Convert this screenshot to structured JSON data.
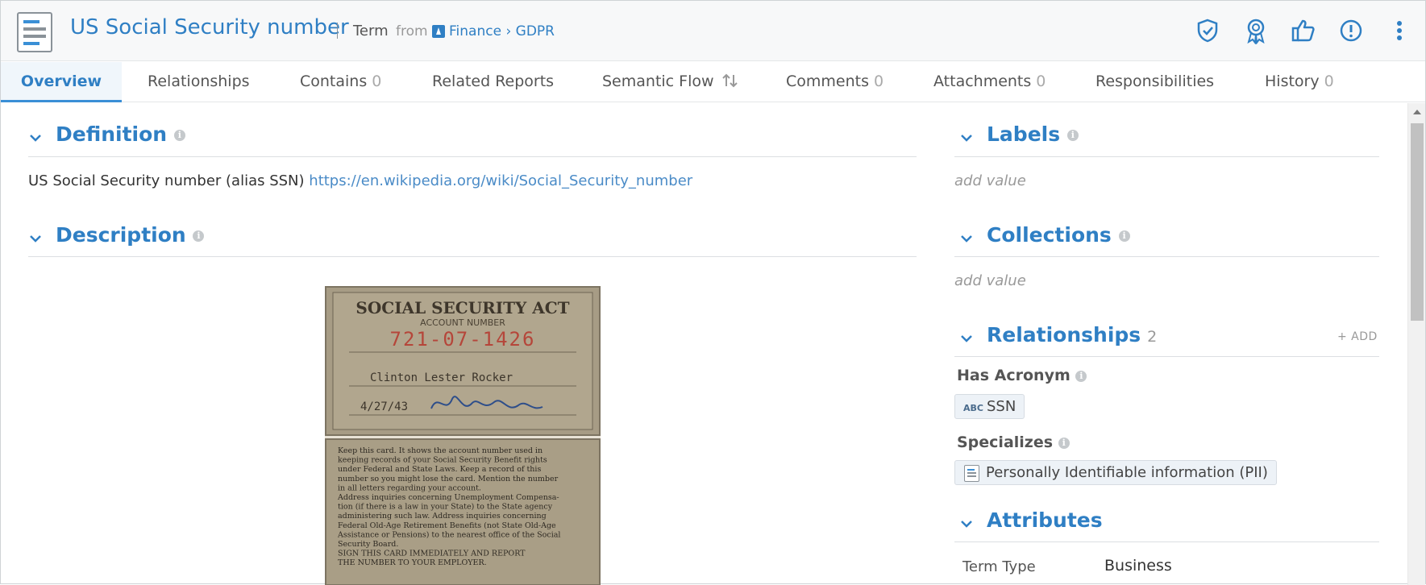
{
  "header": {
    "title": "US Social Security number",
    "type": "Term",
    "from": "from",
    "breadcrumb": "Finance › GDPR",
    "actions": [
      {
        "icon": "shield-check-icon"
      },
      {
        "icon": "award-icon"
      },
      {
        "icon": "thumbs-up-icon"
      },
      {
        "icon": "alert-icon"
      },
      {
        "icon": "more-vertical-icon"
      }
    ]
  },
  "tabs": [
    {
      "label": "Overview",
      "count": "",
      "active": true
    },
    {
      "label": "Relationships",
      "count": ""
    },
    {
      "label": "Contains",
      "count": "0"
    },
    {
      "label": "Related Reports",
      "count": ""
    },
    {
      "label": "Semantic Flow",
      "count": ""
    },
    {
      "label": "Comments",
      "count": "0"
    },
    {
      "label": "Attachments",
      "count": "0"
    },
    {
      "label": "Responsibilities",
      "count": ""
    },
    {
      "label": "History",
      "count": "0"
    }
  ],
  "definition": {
    "title": "Definition",
    "text": "US Social Security number (alias SSN)",
    "link": "https://en.wikipedia.org/wiki/Social_Security_number"
  },
  "description": {
    "title": "Description",
    "card": {
      "header": "SOCIAL SECURITY ACT",
      "sub": "ACCOUNT NUMBER",
      "number": "721-07-1426",
      "name": "Clinton Lester Rocker",
      "date": "4/27/43",
      "body": [
        "Keep this card. It shows the account number used in",
        "keeping records of your Social Security Benefit rights",
        "under Federal and State Laws. Keep a record of this",
        "number so you might lose the card. Mention the number",
        "in all letters regarding your account.",
        "Address inquiries concerning Unemployment Compensa-",
        "tion (if there is a law in your State) to the State agency",
        "administering such law. Address inquiries concerning",
        "Federal Old-Age Retirement Benefits (not State Old-Age",
        "Assistance or Pensions) to the nearest office of the Social",
        "Security Board.",
        "SIGN THIS CARD IMMEDIATELY AND REPORT",
        "THE NUMBER TO YOUR EMPLOYER."
      ]
    }
  },
  "labels": {
    "title": "Labels",
    "add_value": "add value"
  },
  "collections": {
    "title": "Collections",
    "add_value": "add value"
  },
  "relationships": {
    "title": "Relationships",
    "count": "2",
    "add": "+ ADD",
    "has_acronym_label": "Has Acronym",
    "acronym_badge": "ABC",
    "acronym_value": "SSN",
    "specializes_label": "Specializes",
    "specializes_value": "Personally Identifiable information (PII)"
  },
  "attributes": {
    "title": "Attributes",
    "rows": [
      {
        "key": "Term Type",
        "value": "Business"
      }
    ]
  }
}
